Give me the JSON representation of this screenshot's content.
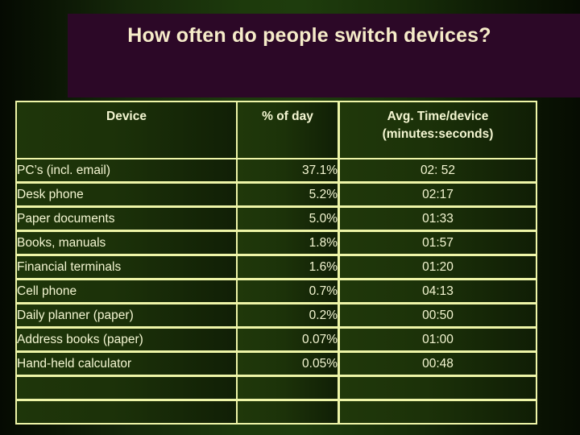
{
  "slide": {
    "title": "How often do people switch devices?",
    "banner_color": "#2c0827",
    "title_color": "#f6ecc9",
    "border_color": "#eef5a8"
  },
  "table": {
    "headers": {
      "device": "Device",
      "percent": "% of day",
      "time_line1": "Avg. Time/device",
      "time_line2": "(minutes:seconds)"
    },
    "rows": [
      {
        "device": "PC’s (incl. email)",
        "percent": "37.1%",
        "time": "02: 52"
      },
      {
        "device": "Desk phone",
        "percent": "5.2%",
        "time": "02:17"
      },
      {
        "device": "Paper documents",
        "percent": "5.0%",
        "time": "01:33"
      },
      {
        "device": "Books, manuals",
        "percent": "1.8%",
        "time": "01:57"
      },
      {
        "device": "Financial terminals",
        "percent": "1.6%",
        "time": "01:20"
      },
      {
        "device": "Cell phone",
        "percent": "0.7%",
        "time": "04:13"
      },
      {
        "device": "Daily planner (paper)",
        "percent": "0.2%",
        "time": "00:50"
      },
      {
        "device": "Address books (paper)",
        "percent": "0.07%",
        "time": "01:00"
      },
      {
        "device": "Hand-held calculator",
        "percent": "0.05%",
        "time": "00:48"
      },
      {
        "device": "",
        "percent": "",
        "time": ""
      },
      {
        "device": "",
        "percent": "",
        "time": ""
      }
    ]
  }
}
